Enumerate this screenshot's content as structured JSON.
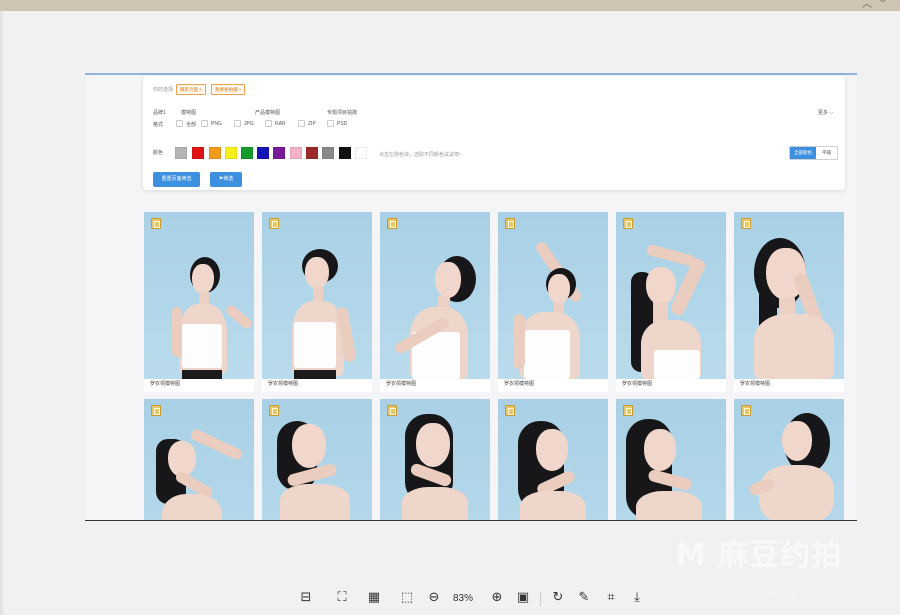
{
  "window": {
    "collapse_icon": "︿",
    "dropdown_icon": "﹀"
  },
  "filters": {
    "selected_label": "你的选择",
    "tags": [
      "摄影页面 ×",
      "我要要拍摄 ×"
    ],
    "category_label": "品牌1",
    "categories": [
      "模特图",
      "产品模特图",
      "专题项目拍摄"
    ],
    "more": "更多 ⌵",
    "format_label": "格式",
    "formats": [
      "全部",
      "PNG",
      "JPG",
      "RAR",
      "ZIP",
      "PSD"
    ],
    "color_label": "颜色",
    "colors": [
      "#b5b5b5",
      "#e01414",
      "#f39a1b",
      "#f5f01a",
      "#169a2b",
      "#1414b8",
      "#7a1a9a",
      "#f3b3c6",
      "#9b2a2a",
      "#888888",
      "#111111",
      "#ffffff"
    ],
    "color_hint": "点击左侧色块，选取不同颜色试试吧~",
    "toggle_on": "全部颜色",
    "toggle_off": "平铺",
    "reset_button": "重置页面筛选",
    "filter_button": "筛选"
  },
  "gallery": {
    "items": [
      {
        "caption": "罗衣领模特图"
      },
      {
        "caption": "罗衣领模特图"
      },
      {
        "caption": "罗衣领模特图"
      },
      {
        "caption": "罗衣领模特图"
      },
      {
        "caption": "罗衣领模特图"
      },
      {
        "caption": "罗衣领模特图"
      }
    ]
  },
  "toolbar": {
    "zoom": "83%"
  },
  "watermark": {
    "main": "M 麻豆约拍",
    "sub": "MADOUPHOTOGRAPH"
  }
}
